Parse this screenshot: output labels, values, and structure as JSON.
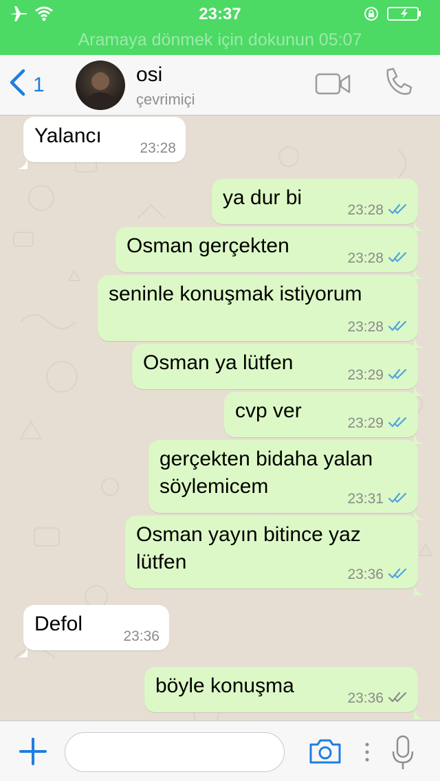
{
  "status_bar": {
    "time": "23:37",
    "call_banner": "Aramaya dönmek için dokunun 05:07",
    "icons": [
      "airplane-icon",
      "wifi-icon",
      "rotation-lock-icon",
      "battery-charging-icon"
    ],
    "color": "#4cd964"
  },
  "header": {
    "back_count": "1",
    "contact_name": "osi",
    "presence": "çevrimiçi",
    "icons": [
      "back-chevron-icon",
      "video-call-icon",
      "phone-call-icon"
    ],
    "accent_color": "#1d7ee0"
  },
  "messages": [
    {
      "direction": "in",
      "text": "Yalancı",
      "time": "23:28"
    },
    {
      "direction": "out",
      "text": "ya dur bi",
      "time": "23:28",
      "status": "read"
    },
    {
      "direction": "out",
      "text": "Osman gerçekten",
      "time": "23:28",
      "status": "read"
    },
    {
      "direction": "out",
      "text": "seninle konuşmak istiyorum",
      "time": "23:28",
      "status": "read"
    },
    {
      "direction": "out",
      "text": "Osman ya lütfen",
      "time": "23:29",
      "status": "read"
    },
    {
      "direction": "out",
      "text": "cvp ver",
      "time": "23:29",
      "status": "read"
    },
    {
      "direction": "out",
      "text": "gerçekten bidaha yalan",
      "text2": "söylemicem",
      "time": "23:31",
      "status": "read"
    },
    {
      "direction": "out",
      "text": "Osman yayın bitince yaz",
      "text2": "lütfen",
      "time": "23:36",
      "status": "read"
    },
    {
      "direction": "in",
      "text": "Defol",
      "time": "23:36"
    },
    {
      "direction": "out",
      "text": "böyle konuşma",
      "time": "23:36",
      "status": "delivered"
    }
  ],
  "colors": {
    "incoming_bubble": "#ffffff",
    "outgoing_bubble": "#dcf8c6",
    "read_ticks": "#4fa3e0",
    "delivered_ticks": "#8a8a8a"
  },
  "input_bar": {
    "placeholder": "",
    "icons": [
      "plus-icon",
      "camera-icon",
      "more-dots-icon",
      "microphone-icon"
    ]
  }
}
